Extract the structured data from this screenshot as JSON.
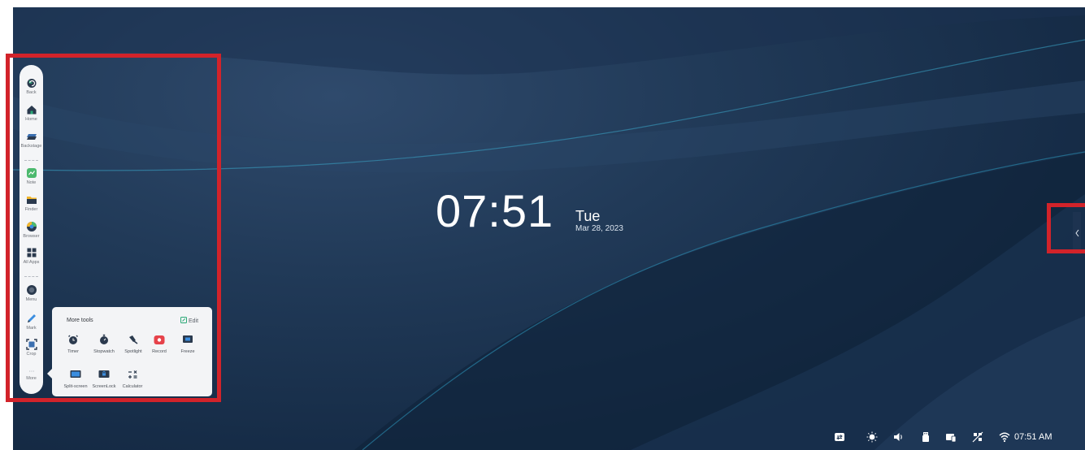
{
  "clock": {
    "time": "07:51",
    "day": "Tue",
    "date": "Mar 28, 2023"
  },
  "sidebar": {
    "items": [
      {
        "label": "Back",
        "icon": "back-icon"
      },
      {
        "label": "Home",
        "icon": "home-icon"
      },
      {
        "label": "Backstage",
        "icon": "backstage-icon"
      },
      {
        "label": "Note",
        "icon": "note-icon"
      },
      {
        "label": "Finder",
        "icon": "folder-icon"
      },
      {
        "label": "Browser",
        "icon": "browser-icon"
      },
      {
        "label": "All Apps",
        "icon": "apps-grid-icon"
      },
      {
        "label": "Menu",
        "icon": "menu-icon"
      },
      {
        "label": "Mark",
        "icon": "pen-icon"
      },
      {
        "label": "Crop",
        "icon": "crop-icon"
      },
      {
        "label": "More",
        "icon": "more-icon"
      }
    ]
  },
  "more_tools": {
    "title": "More tools",
    "edit_label": "Edit",
    "tools": [
      {
        "label": "Timer",
        "icon": "timer-icon"
      },
      {
        "label": "Stopwatch",
        "icon": "stopwatch-icon"
      },
      {
        "label": "Spotlight",
        "icon": "spotlight-icon"
      },
      {
        "label": "Record",
        "icon": "record-icon"
      },
      {
        "label": "Freeze",
        "icon": "freeze-icon"
      },
      {
        "label": "Split-screen",
        "icon": "split-screen-icon"
      },
      {
        "label": "ScreenLock",
        "icon": "screen-lock-icon"
      },
      {
        "label": "Calculator",
        "icon": "calculator-icon"
      }
    ]
  },
  "status_bar": {
    "time": "07:51 AM",
    "icons": [
      "input-source-icon",
      "brightness-icon",
      "volume-icon",
      "usb-icon",
      "cast-icon",
      "network-disconnected-icon",
      "wifi-icon"
    ]
  },
  "colors": {
    "highlight": "#d2232a",
    "accent_green": "#2aa876"
  }
}
